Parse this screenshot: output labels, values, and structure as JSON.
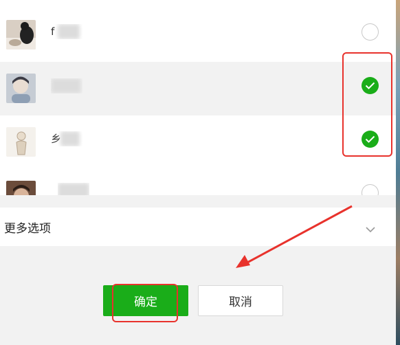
{
  "contacts": [
    {
      "name_visible": "f",
      "checked": false
    },
    {
      "name_visible": "",
      "checked": true
    },
    {
      "name_visible": "乡",
      "checked": true
    },
    {
      "name_visible": "",
      "checked": false
    }
  ],
  "more_options": {
    "label": "更多选项",
    "icon": "chevron-down-icon"
  },
  "buttons": {
    "confirm_label": "确定",
    "cancel_label": "取消"
  },
  "colors": {
    "accent": "#1aad19",
    "annotation": "#e8322c"
  }
}
